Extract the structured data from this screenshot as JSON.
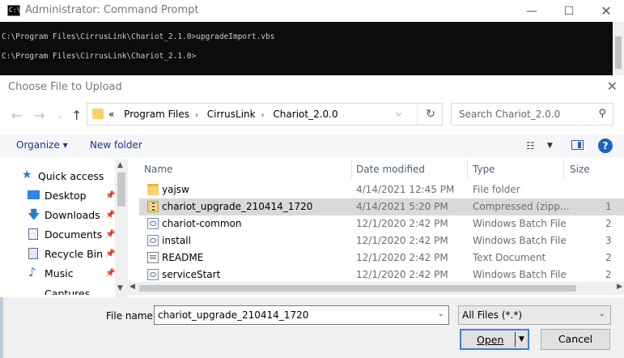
{
  "cmd": {
    "title": "Administrator: Command Prompt",
    "icon_text": "C:\\.",
    "lines": [
      "C:\\Program Files\\CirrusLink\\Chariot_2.1.0>upgradeImport.vbs",
      "C:\\Program Files\\CirrusLink\\Chariot_2.1.0>"
    ]
  },
  "dialog": {
    "title": "Choose File to Upload",
    "breadcrumb": [
      "«",
      "Program Files",
      "CirrusLink",
      "Chariot_2.0.0"
    ],
    "search_placeholder": "Search Chariot_2.0.0",
    "organize": "Organize ▾",
    "new_folder": "New folder",
    "nav_items": [
      {
        "label": "Quick access",
        "icon": "star-icon",
        "pinned": false
      },
      {
        "label": "Desktop",
        "icon": "desktop-icon",
        "pinned": true
      },
      {
        "label": "Downloads",
        "icon": "download-icon",
        "pinned": true
      },
      {
        "label": "Documents",
        "icon": "documents-icon",
        "pinned": true
      },
      {
        "label": "Recycle Bin",
        "icon": "recycle-bin-icon",
        "pinned": true
      },
      {
        "label": "Music",
        "icon": "music-icon",
        "pinned": true
      },
      {
        "label": "Captures",
        "icon": "folder-icon",
        "pinned": false
      }
    ],
    "columns": [
      "Name",
      "Date modified",
      "Type",
      "Size"
    ],
    "files": [
      {
        "name": "yajsw",
        "date": "4/14/2021 12:45 PM",
        "type": "File folder",
        "size": "",
        "icon": "folder-icon",
        "selected": false
      },
      {
        "name": "chariot_upgrade_210414_1720",
        "date": "4/14/2021 5:20 PM",
        "type": "Compressed (zipp...",
        "size": "1",
        "icon": "zip-icon",
        "selected": true
      },
      {
        "name": "chariot-common",
        "date": "12/1/2020 2:42 PM",
        "type": "Windows Batch File",
        "size": "2",
        "icon": "batch-file-icon",
        "selected": false
      },
      {
        "name": "install",
        "date": "12/1/2020 2:42 PM",
        "type": "Windows Batch File",
        "size": "3",
        "icon": "batch-file-icon",
        "selected": false
      },
      {
        "name": "README",
        "date": "12/1/2020 2:42 PM",
        "type": "Text Document",
        "size": "2",
        "icon": "text-file-icon",
        "selected": false
      },
      {
        "name": "serviceStart",
        "date": "12/1/2020 2:42 PM",
        "type": "Windows Batch File",
        "size": "2",
        "icon": "batch-file-icon",
        "selected": false
      }
    ],
    "file_name_label": "File name:",
    "file_name_value": "chariot_upgrade_210414_1720",
    "file_type": "All Files (*.*)",
    "open_label": "Open",
    "cancel_label": "Cancel"
  }
}
